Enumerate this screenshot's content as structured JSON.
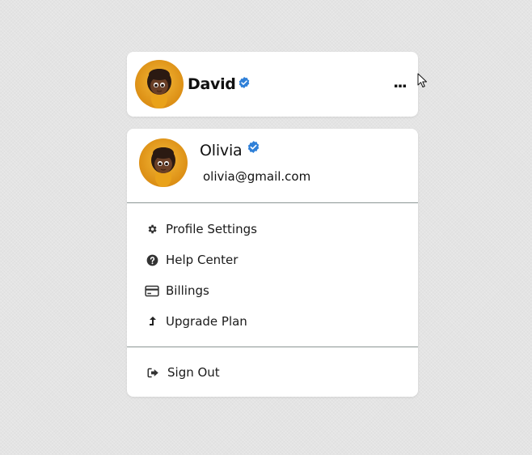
{
  "header": {
    "user_name": "David",
    "more_icon": "ellipsis-horizontal",
    "verified_icon": "verified-badge"
  },
  "menu": {
    "user_name": "Olivia",
    "email": "olivia@gmail.com",
    "items": [
      {
        "label": "Profile Settings",
        "icon": "gear-icon"
      },
      {
        "label": "Help Center",
        "icon": "question-circle-icon"
      },
      {
        "label": "Billings",
        "icon": "credit-card-icon"
      },
      {
        "label": "Upgrade Plan",
        "icon": "arrow-up-icon"
      }
    ],
    "sign_out": {
      "label": "Sign Out",
      "icon": "sign-out-icon"
    }
  },
  "colors": {
    "verified": "#2f80d8",
    "avatar_bg": "#e49e1e",
    "divider": "#8c9694",
    "background": "#e4e4e4"
  }
}
